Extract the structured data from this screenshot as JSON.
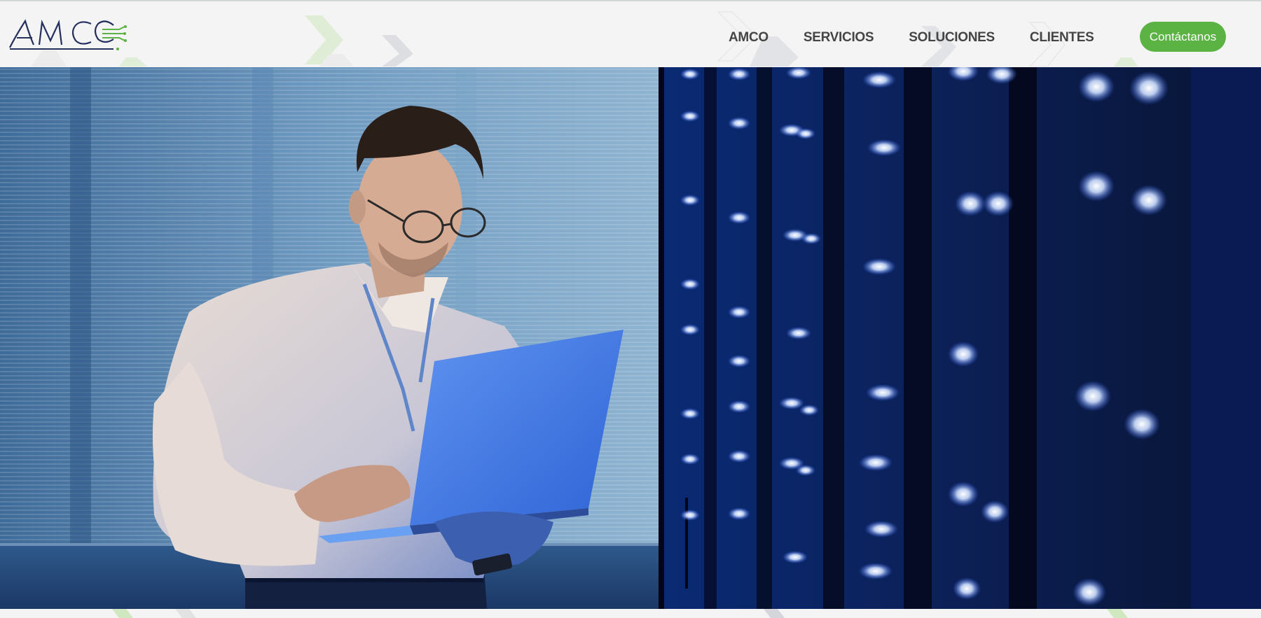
{
  "brand": {
    "logo_text": "AMC",
    "colors": {
      "navy": "#24305e",
      "green": "#5ab343",
      "nav_text": "#454545"
    }
  },
  "nav": {
    "items": [
      {
        "label": "AMCO"
      },
      {
        "label": "SERVICIOS"
      },
      {
        "label": "SOLUCIONES"
      },
      {
        "label": "CLIENTES"
      }
    ],
    "cta_label": "Contáctanos"
  },
  "hero": {
    "image_icon": "man-with-laptop-in-server-room-photo"
  }
}
